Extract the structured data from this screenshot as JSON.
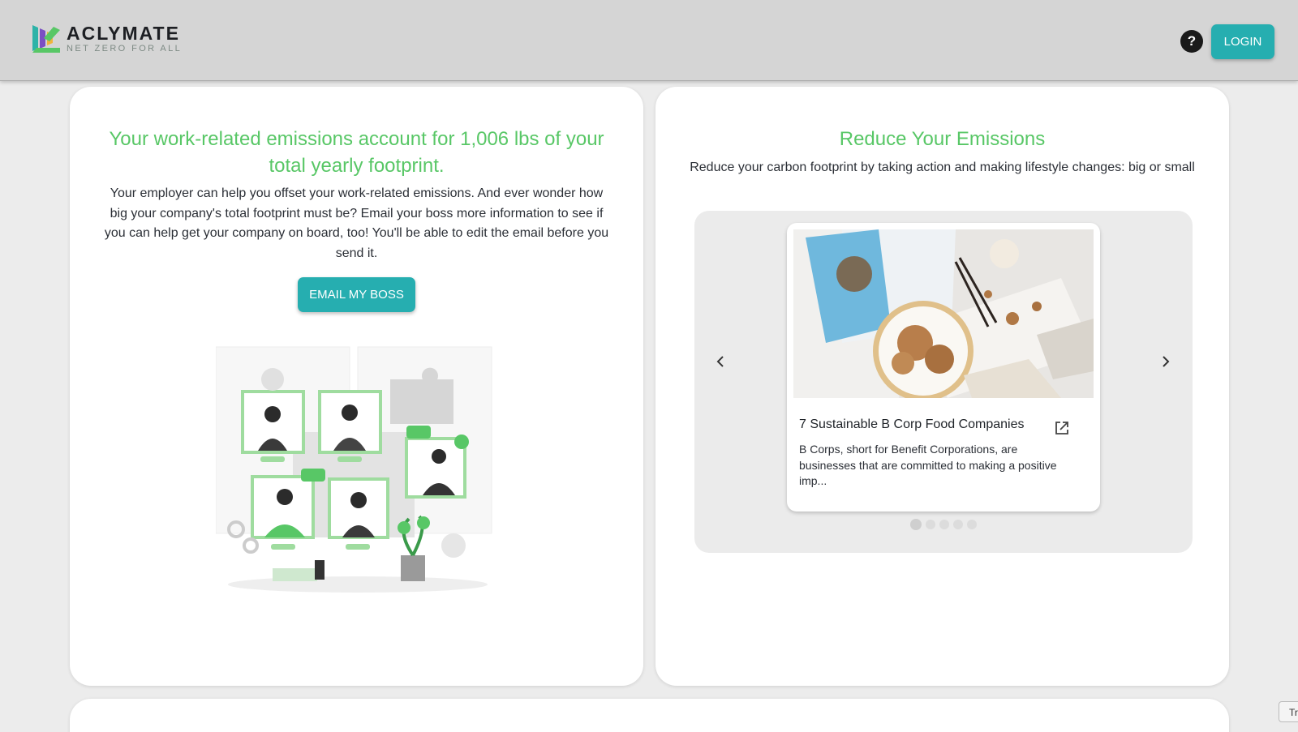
{
  "header": {
    "brand_name": "ACLYMATE",
    "brand_tagline": "NET ZERO FOR ALL",
    "help_label": "?",
    "login_label": "LOGIN",
    "accent_color": "#26aeb0"
  },
  "work_card": {
    "headline": "Your work-related emissions account for 1,006 lbs of your total yearly footprint.",
    "body": "Your employer can help you offset your work-related emissions. And ever wonder how big your company's total footprint must be? Email your boss more information to see if you can help get your company on board, too! You'll be able to edit the email before you send it.",
    "button_label": "EMAIL MY BOSS",
    "headline_color": "#58c766"
  },
  "reduce_card": {
    "headline": "Reduce Your Emissions",
    "body": "Reduce your carbon footprint by taking action and making lifestyle changes: big or small",
    "carousel": {
      "prev_icon": "chevron-left-icon",
      "next_icon": "chevron-right-icon",
      "slide": {
        "title": "7 Sustainable B Corp Food Companies",
        "description": "B Corps, short for Benefit Corporations, are businesses that are committed to making a positive imp...",
        "link_icon": "external-link-icon"
      },
      "total_slides": 5,
      "active_slide": 1
    }
  },
  "corner_tab": {
    "label": "Tr"
  }
}
